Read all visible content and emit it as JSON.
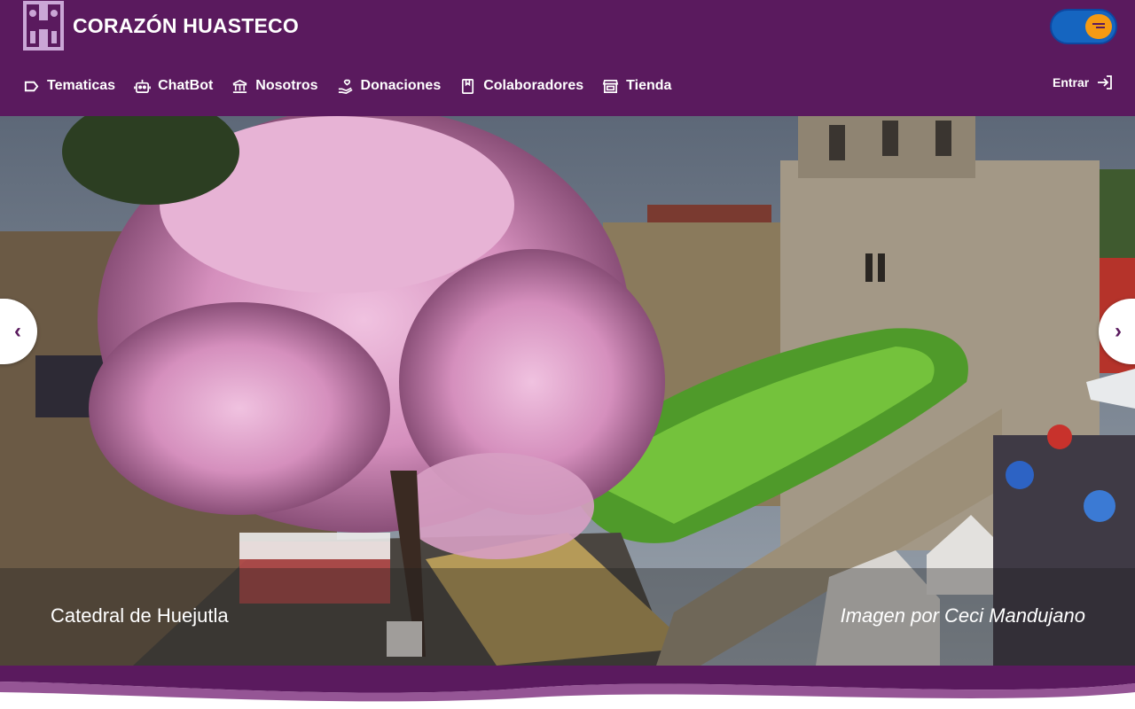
{
  "header": {
    "brand_title": "CORAZÓN HUASTECO",
    "logo_letter": "H",
    "accent": "#5a1a5e",
    "toggle_color": "#1565c0",
    "toggle_knob_color": "#f59a13"
  },
  "nav": {
    "items": [
      {
        "label": "Tematicas",
        "icon": "tag-icon"
      },
      {
        "label": "ChatBot",
        "icon": "robot-icon"
      },
      {
        "label": "Nosotros",
        "icon": "institution-icon"
      },
      {
        "label": "Donaciones",
        "icon": "donate-hand-icon"
      },
      {
        "label": "Colaboradores",
        "icon": "bookmark-book-icon"
      },
      {
        "label": "Tienda",
        "icon": "store-icon"
      }
    ],
    "login_label": "Entrar",
    "login_icon": "login-arrow-icon"
  },
  "carousel": {
    "caption_title": "Catedral de Huejutla",
    "caption_credit": "Imagen por Ceci Mandujano",
    "prev_icon": "chevron-left-icon",
    "next_icon": "chevron-right-icon",
    "prev_glyph": "‹",
    "next_glyph": "›"
  }
}
